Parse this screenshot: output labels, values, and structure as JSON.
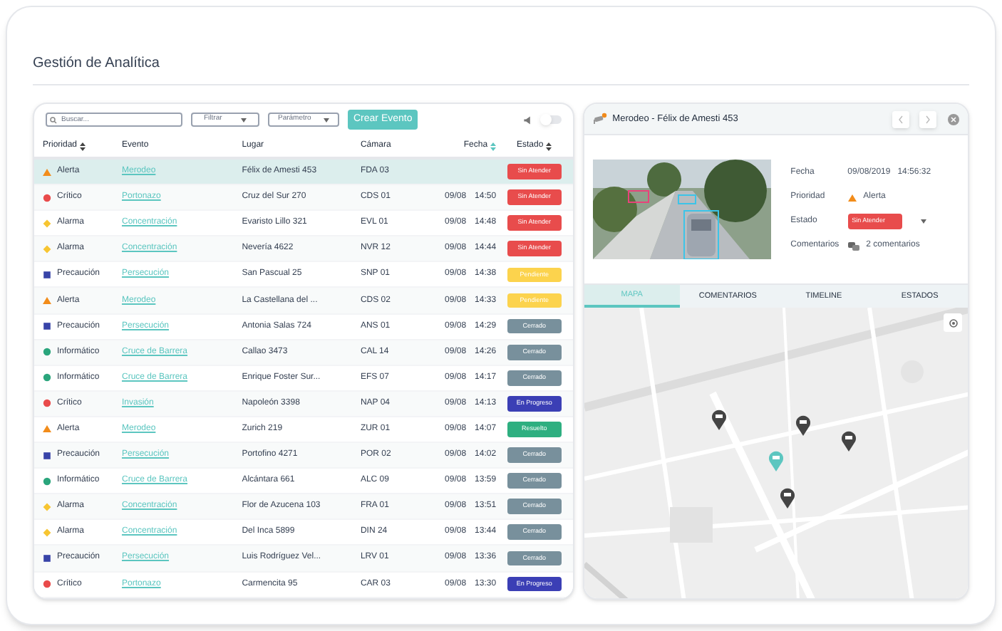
{
  "page_title": "Gestión de Analítica",
  "toolbar": {
    "search_placeholder": "Buscar...",
    "filter": "Filtrar",
    "parameter": "Parámetro",
    "create_button": "Crear Evento",
    "sound_toggle_on": false
  },
  "table": {
    "columns": [
      {
        "label": "Prioridad",
        "sortable": true
      },
      {
        "label": "Evento",
        "sortable": false
      },
      {
        "label": "Lugar",
        "sortable": false
      },
      {
        "label": "Cámara",
        "sortable": false
      },
      {
        "label": "Fecha",
        "sortable": true
      },
      {
        "label": "Estado",
        "sortable": true
      }
    ],
    "rows": [
      {
        "selected": true,
        "priority": {
          "kind": "alerta",
          "label": "Alerta"
        },
        "event": "Merodeo",
        "place": "Félix de Amesti 453",
        "camera": "FDA 03",
        "status": {
          "kind": "sin_atender",
          "label": "Sin Atender"
        }
      },
      {
        "selected": false,
        "priority": {
          "kind": "critico",
          "label": "Crítico"
        },
        "event": "Portonazo",
        "place": "Cruz del Sur 270",
        "camera": "CDS 01",
        "date": "09/08",
        "time": "14:50",
        "status": {
          "kind": "sin_atender",
          "label": "Sin Atender"
        }
      },
      {
        "selected": false,
        "priority": {
          "kind": "alarma",
          "label": "Alarma"
        },
        "event": "Concentración",
        "place": "Evaristo Lillo 321",
        "camera": "EVL 01",
        "date": "09/08",
        "time": "14:48",
        "status": {
          "kind": "sin_atender",
          "label": "Sin Atender"
        }
      },
      {
        "selected": false,
        "priority": {
          "kind": "alarma",
          "label": "Alarma"
        },
        "event": "Concentración",
        "place": "Nevería 4622",
        "camera": "NVR 12",
        "date": "09/08",
        "time": "14:44",
        "status": {
          "kind": "sin_atender",
          "label": "Sin Atender"
        }
      },
      {
        "selected": false,
        "priority": {
          "kind": "precaucion",
          "label": "Precaución"
        },
        "event": "Persecución",
        "place": "San Pascual 25",
        "camera": "SNP 01",
        "date": "09/08",
        "time": "14:38",
        "status": {
          "kind": "pendiente",
          "label": "Pendiente"
        }
      },
      {
        "selected": false,
        "priority": {
          "kind": "alerta",
          "label": "Alerta"
        },
        "event": "Merodeo",
        "place": "La Castellana del ...",
        "camera": "CDS 02",
        "date": "09/08",
        "time": "14:33",
        "status": {
          "kind": "pendiente",
          "label": "Pendiente"
        }
      },
      {
        "selected": false,
        "priority": {
          "kind": "precaucion",
          "label": "Precaución"
        },
        "event": "Persecución",
        "place": "Antonia Salas 724",
        "camera": "ANS 01",
        "date": "09/08",
        "time": "14:29",
        "status": {
          "kind": "cerrado",
          "label": "Cerrado"
        }
      },
      {
        "selected": false,
        "priority": {
          "kind": "informatico",
          "label": "Informático"
        },
        "event": "Cruce de Barrera",
        "place": "Callao 3473",
        "camera": "CAL 14",
        "date": "09/08",
        "time": "14:26",
        "status": {
          "kind": "cerrado",
          "label": "Cerrado"
        }
      },
      {
        "selected": false,
        "priority": {
          "kind": "informatico",
          "label": "Informático"
        },
        "event": "Cruce de Barrera",
        "place": "Enrique Foster Sur...",
        "camera": "EFS 07",
        "date": "09/08",
        "time": "14:17",
        "status": {
          "kind": "cerrado",
          "label": "Cerrado"
        }
      },
      {
        "selected": false,
        "priority": {
          "kind": "critico",
          "label": "Crítico"
        },
        "event": "Invasión",
        "place": "Napoleón 3398",
        "camera": "NAP 04",
        "date": "09/08",
        "time": "14:13",
        "status": {
          "kind": "en_progreso",
          "label": "En Progreso"
        }
      },
      {
        "selected": false,
        "priority": {
          "kind": "alerta",
          "label": "Alerta"
        },
        "event": "Merodeo",
        "place": "Zurich 219",
        "camera": "ZUR 01",
        "date": "09/08",
        "time": "14:07",
        "status": {
          "kind": "resuelto",
          "label": "Resuelto"
        }
      },
      {
        "selected": false,
        "priority": {
          "kind": "precaucion",
          "label": "Precaución"
        },
        "event": "Persecución",
        "place": "Portofino 4271",
        "camera": "POR 02",
        "date": "09/08",
        "time": "14:02",
        "status": {
          "kind": "cerrado",
          "label": "Cerrado"
        }
      },
      {
        "selected": false,
        "priority": {
          "kind": "informatico",
          "label": "Informático"
        },
        "event": "Cruce de Barrera",
        "place": "Alcántara 661",
        "camera": "ALC 09",
        "date": "09/08",
        "time": "13:59",
        "status": {
          "kind": "cerrado",
          "label": "Cerrado"
        }
      },
      {
        "selected": false,
        "priority": {
          "kind": "alarma",
          "label": "Alarma"
        },
        "event": "Concentración",
        "place": "Flor de Azucena 103",
        "camera": "FRA 01",
        "date": "09/08",
        "time": "13:51",
        "status": {
          "kind": "cerrado",
          "label": "Cerrado"
        }
      },
      {
        "selected": false,
        "priority": {
          "kind": "alarma",
          "label": "Alarma"
        },
        "event": "Concentración",
        "place": "Del Inca 5899",
        "camera": "DIN 24",
        "date": "09/08",
        "time": "13:44",
        "status": {
          "kind": "cerrado",
          "label": "Cerrado"
        }
      },
      {
        "selected": false,
        "priority": {
          "kind": "precaucion",
          "label": "Precaución"
        },
        "event": "Persecución",
        "place": "Luis Rodríguez Vel...",
        "camera": "LRV 01",
        "date": "09/08",
        "time": "13:36",
        "status": {
          "kind": "cerrado",
          "label": "Cerrado"
        }
      },
      {
        "selected": false,
        "priority": {
          "kind": "critico",
          "label": "Crítico"
        },
        "event": "Portonazo",
        "place": "Carmencita 95",
        "camera": "CAR 03",
        "date": "09/08",
        "time": "13:30",
        "status": {
          "kind": "en_progreso",
          "label": "En Progreso"
        }
      }
    ]
  },
  "detail": {
    "title": "Merodeo - Félix de Amesti 453",
    "fields": [
      {
        "kind": "date",
        "label": "Fecha",
        "date": "09/08/2019",
        "time": "14:56:32"
      },
      {
        "kind": "priority",
        "label": "Prioridad",
        "priority": {
          "kind": "alerta",
          "label": "Alerta"
        }
      },
      {
        "kind": "status",
        "label": "Estado",
        "status": {
          "kind": "sin_atender",
          "label": "Sin Atender"
        }
      },
      {
        "kind": "comments",
        "label": "Comentarios",
        "value": "2 comentarios"
      }
    ],
    "tabs": [
      {
        "label": "MAPA",
        "selected": true
      },
      {
        "label": "COMENTARIOS",
        "selected": false
      },
      {
        "label": "TIMELINE",
        "selected": false
      },
      {
        "label": "ESTADOS",
        "selected": false
      }
    ],
    "map_markers": [
      {
        "selected": false
      },
      {
        "selected": false
      },
      {
        "selected": false
      },
      {
        "selected": true
      },
      {
        "selected": false
      }
    ]
  }
}
